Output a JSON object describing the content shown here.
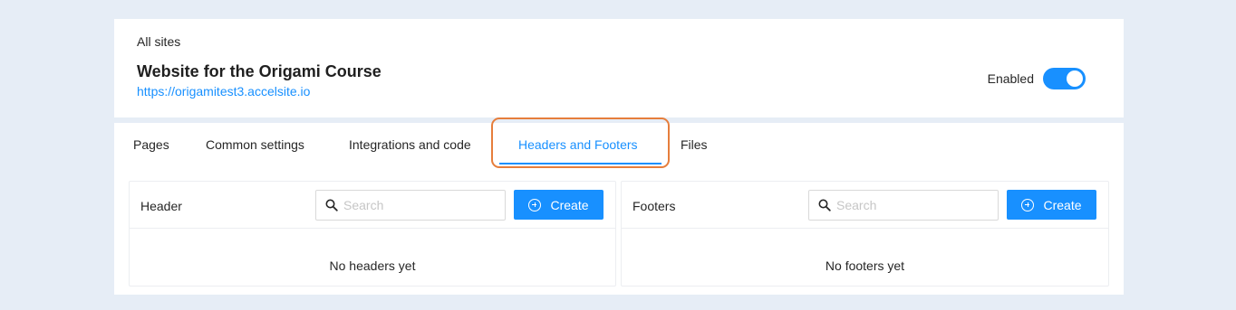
{
  "site": {
    "breadcrumb": "All sites",
    "title": "Website for the Origami Course",
    "url": "https://origamitest3.accelsite.io",
    "enabled_label": "Enabled",
    "enabled": true
  },
  "tabs": [
    {
      "label": "Pages",
      "active": false
    },
    {
      "label": "Common settings",
      "active": false
    },
    {
      "label": "Integrations and code",
      "active": false
    },
    {
      "label": "Headers and Footers",
      "active": true
    },
    {
      "label": "Files",
      "active": false
    }
  ],
  "panels": {
    "header": {
      "title": "Header",
      "search_placeholder": "Search",
      "create_label": "Create",
      "empty_text": "No headers yet"
    },
    "footer": {
      "title": "Footers",
      "search_placeholder": "Search",
      "create_label": "Create",
      "empty_text": "No footers yet"
    }
  },
  "colors": {
    "accent": "#1890ff",
    "highlight": "#e67e3c",
    "background": "#e6edf6"
  }
}
